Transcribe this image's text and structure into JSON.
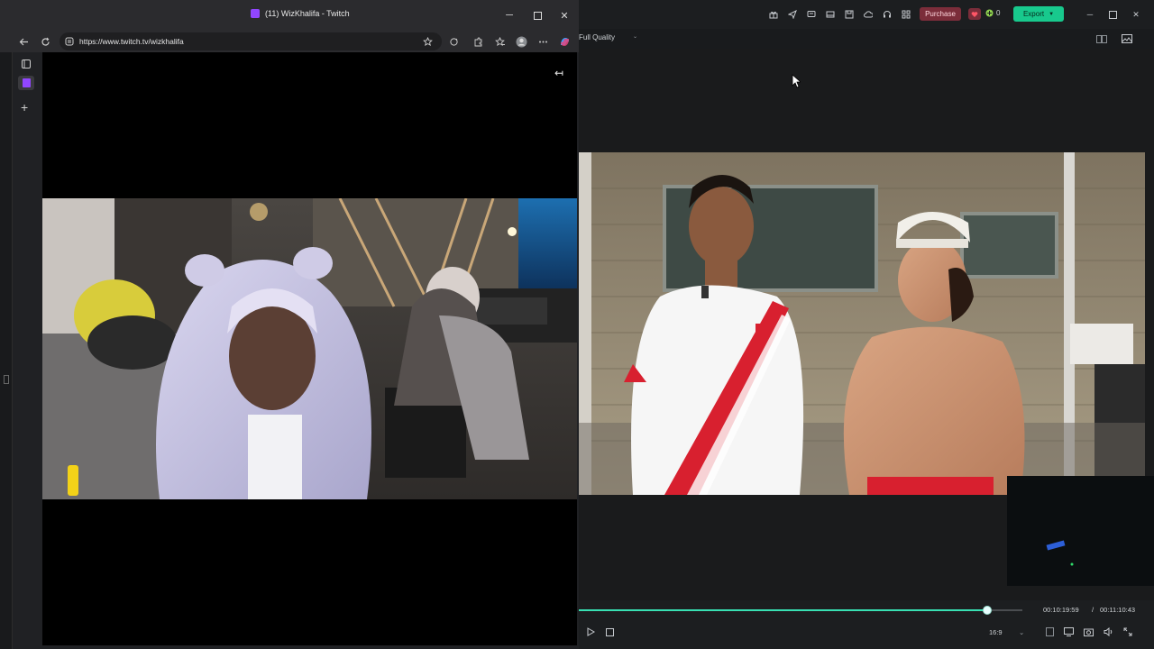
{
  "browser": {
    "window_title": "(11) WizKhalifa - Twitch",
    "url": "https://www.twitch.tv/wizkhalifa",
    "theater_toggle_glyph": "↤"
  },
  "editor": {
    "quality_label": "Full Quality",
    "purchase_label": "Purchase",
    "credit_count": "0",
    "export_label": "Export",
    "current_time": "00:10:19:59",
    "separator": "/",
    "total_time": "00:11:10:43",
    "aspect_ratio": "16:9",
    "progress": 0.92,
    "accent_color": "#18c98d"
  },
  "icons": {
    "back": "arrow-left-icon",
    "reload": "reload-icon",
    "lock": "site-info-icon",
    "star": "favorite-star-icon",
    "play": "play-icon",
    "stop": "stop-icon"
  }
}
